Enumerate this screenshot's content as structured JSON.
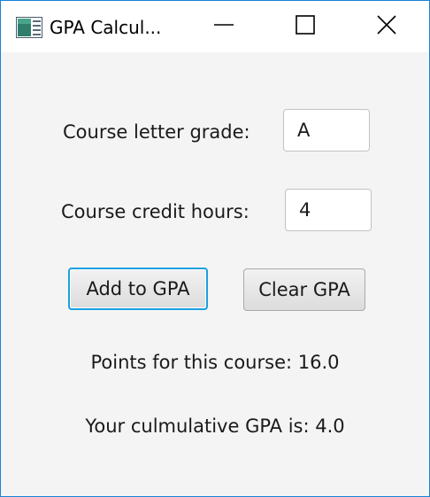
{
  "window": {
    "title": "GPA Calcul...",
    "app_icon": "java-app-icon",
    "controls": {
      "minimize_icon": "minimize-icon",
      "maximize_icon": "maximize-icon",
      "close_icon": "close-icon"
    }
  },
  "form": {
    "grade_label": "Course letter grade:",
    "grade_value": "A",
    "hours_label": "Course credit hours:",
    "hours_value": "4"
  },
  "actions": {
    "add_label": "Add to GPA",
    "clear_label": "Clear GPA"
  },
  "results": {
    "points_text": "Points for this course: 16.0",
    "gpa_text": "Your culmulative GPA is: 4.0"
  },
  "colors": {
    "window_border": "#1883d7",
    "content_bg": "#f4f4f4",
    "focus_ring": "#1a9fe0"
  }
}
